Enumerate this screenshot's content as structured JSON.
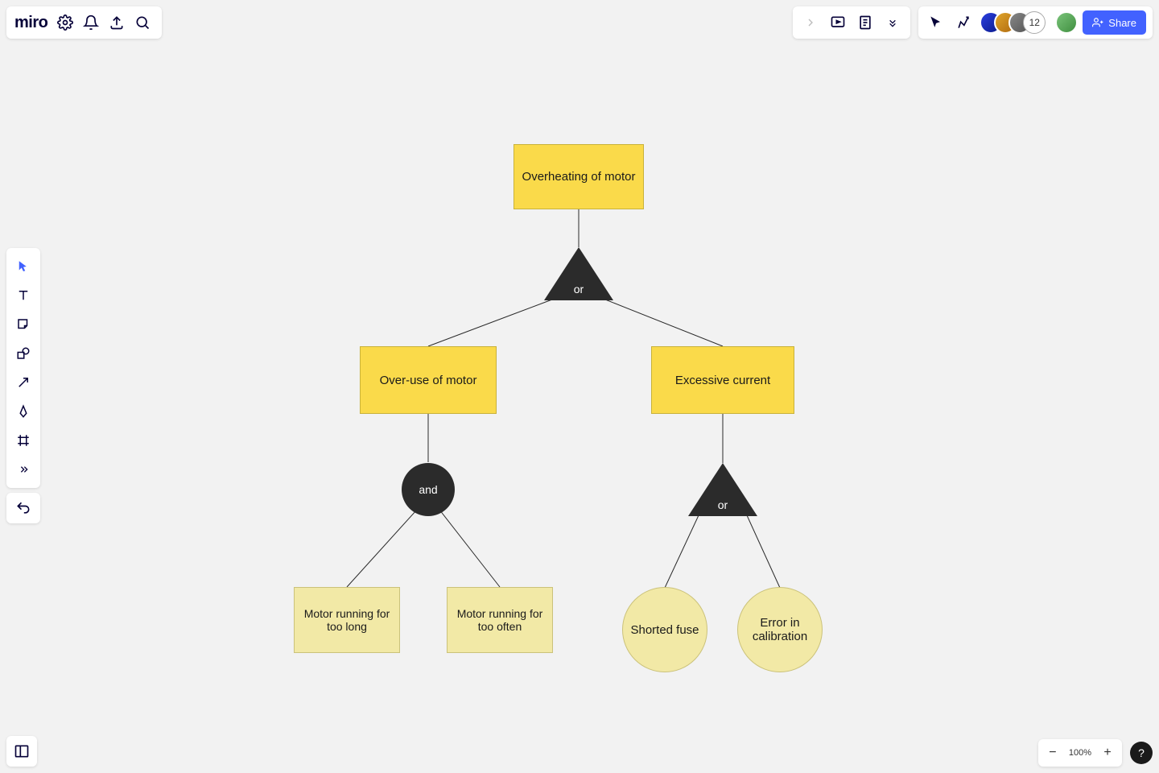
{
  "app": {
    "logo": "miro"
  },
  "share": {
    "label": "Share"
  },
  "collab": {
    "overflow_count": "12"
  },
  "zoom": {
    "value": "100%",
    "help": "?"
  },
  "diagram": {
    "root": "Overheating of motor",
    "gate1": "or",
    "left": "Over-use of motor",
    "right": "Excessive current",
    "gate_left": "and",
    "gate_right": "or",
    "leaf_ll": "Motor running for too long",
    "leaf_lr": "Motor running for too often",
    "leaf_rl": "Shorted fuse",
    "leaf_rr": "Error in calibration"
  }
}
